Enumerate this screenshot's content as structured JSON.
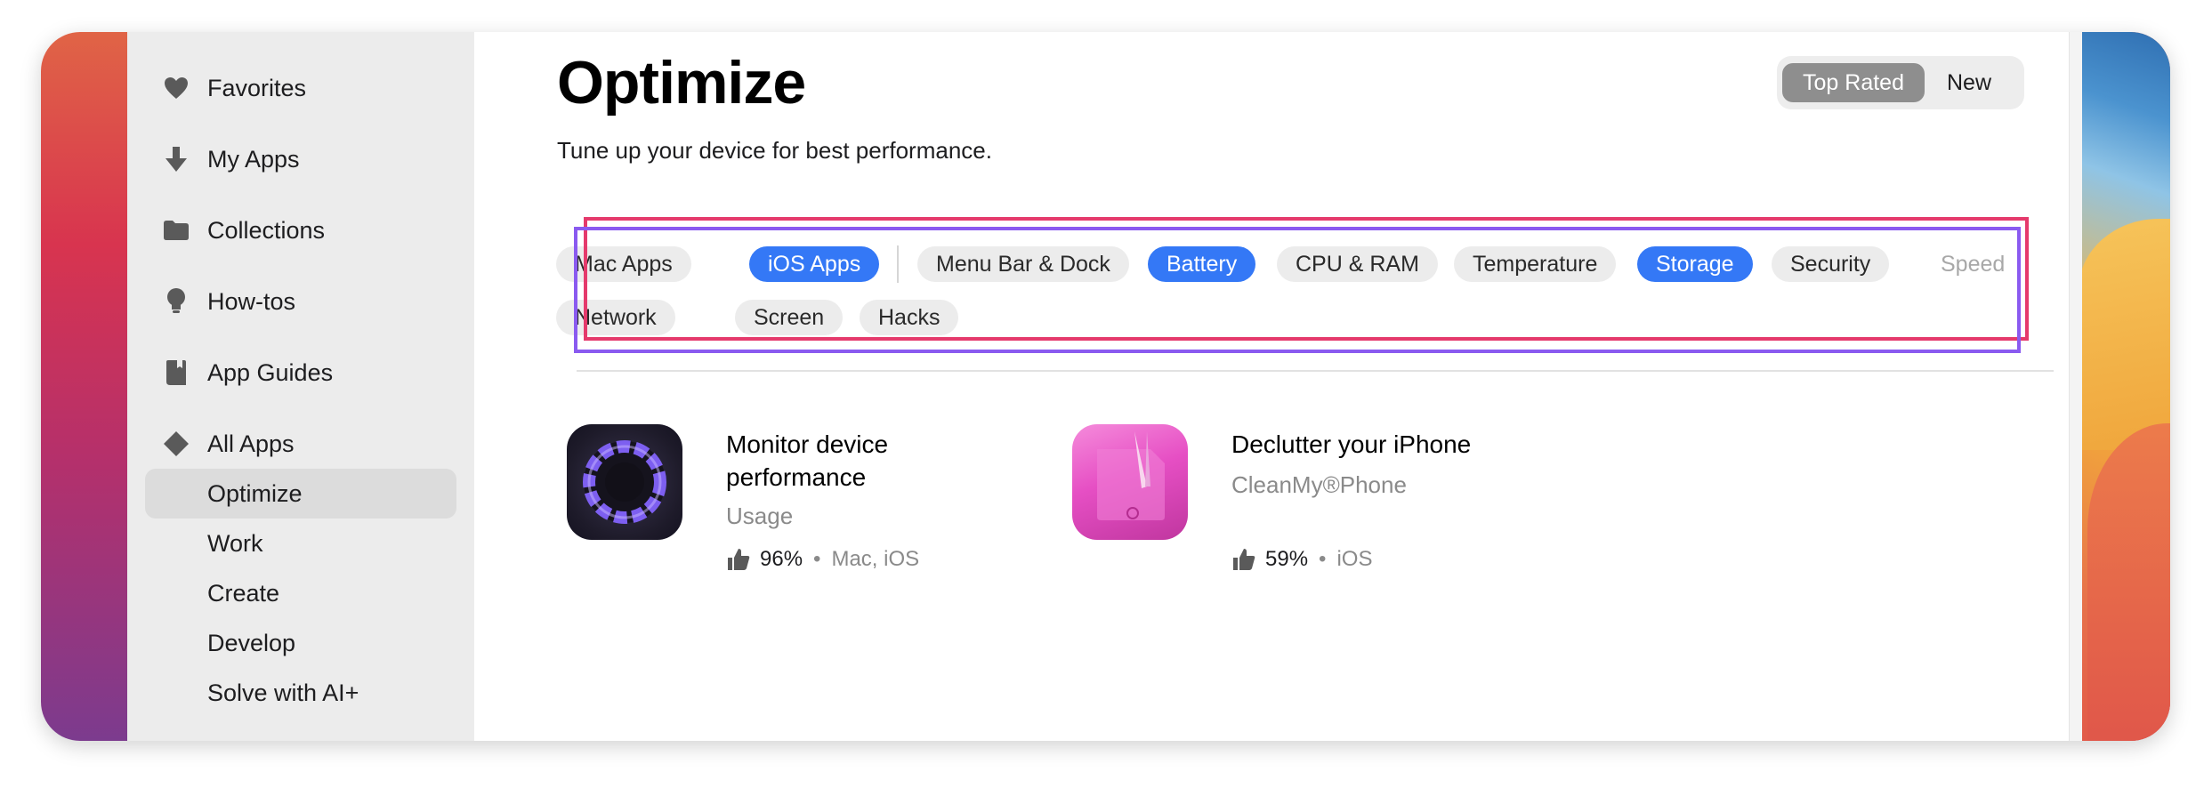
{
  "sidebar": {
    "items": [
      {
        "label": "Favorites",
        "icon": "heart-icon"
      },
      {
        "label": "My Apps",
        "icon": "download-arrow-icon"
      },
      {
        "label": "Collections",
        "icon": "folder-icon"
      },
      {
        "label": "How-tos",
        "icon": "lightbulb-icon"
      },
      {
        "label": "App Guides",
        "icon": "book-icon"
      },
      {
        "label": "All Apps",
        "icon": "diamond-icon"
      }
    ],
    "subitems": [
      "Optimize",
      "Work",
      "Create",
      "Develop",
      "Solve with AI+"
    ],
    "active": "Optimize"
  },
  "header": {
    "title": "Optimize",
    "subtitle": "Tune up your device for best performance.",
    "sort_options": [
      "Top Rated",
      "New"
    ],
    "sort_selected": "Top Rated"
  },
  "filters": {
    "chips": [
      "Mac Apps",
      "iOS Apps",
      "Menu Bar & Dock",
      "Battery",
      "CPU & RAM",
      "Temperature",
      "Storage",
      "Security",
      "Speed",
      "Network",
      "Screen",
      "Hacks"
    ],
    "selected": [
      "iOS Apps",
      "Battery",
      "Storage"
    ]
  },
  "apps": [
    {
      "title_line1": "Monitor device",
      "title_line2": "performance",
      "developer": "Usage",
      "rating": "96%",
      "platforms": "Mac, iOS",
      "icon": "usage-app-icon"
    },
    {
      "title_line1": "Declutter your iPhone",
      "title_line2": "",
      "developer": "CleanMy®Phone",
      "rating": "59%",
      "platforms": "iOS",
      "icon": "cleanmyphone-app-icon"
    }
  ],
  "rating_separator": "•",
  "colors": {
    "accent": "#3478f6",
    "annotation_pink": "#e53a6c",
    "annotation_purple": "#8a5af0"
  }
}
